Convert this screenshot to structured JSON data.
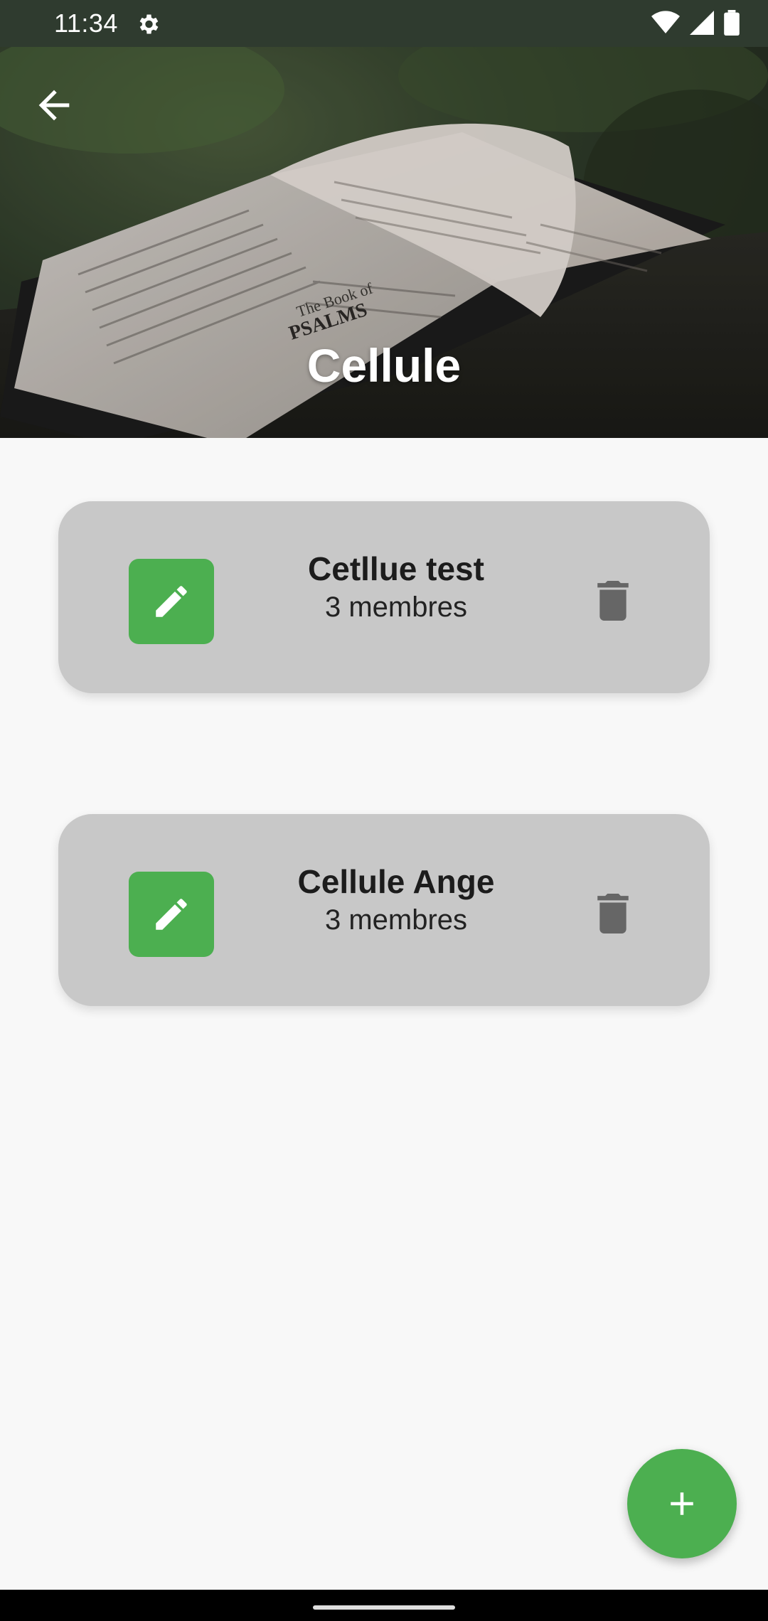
{
  "status_bar": {
    "time": "11:34",
    "icons": [
      "gear-icon",
      "wifi-icon",
      "signal-icon",
      "battery-icon"
    ]
  },
  "header": {
    "title": "Cellule",
    "back_icon": "arrow-left-icon",
    "book_text": {
      "line1": "The Book of",
      "line2": "PSALMS"
    }
  },
  "cells": [
    {
      "name": "Cetllue test",
      "members": "3 membres"
    },
    {
      "name": "Cellule Ange",
      "members": "3 membres"
    }
  ],
  "fab": {
    "icon": "plus-icon"
  },
  "colors": {
    "accent": "#4caf50",
    "card": "#c8c8c8",
    "background": "#f8f8f8",
    "delete_icon": "#666666"
  }
}
